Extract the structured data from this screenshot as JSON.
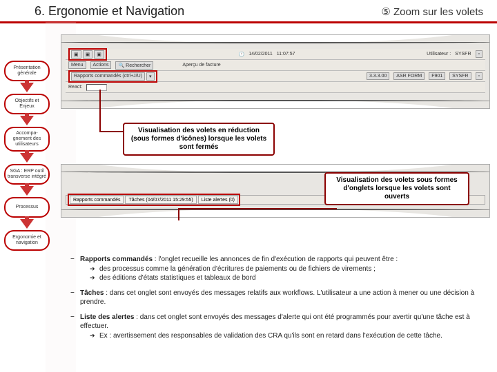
{
  "header": {
    "title": "6. Ergonomie et Navigation",
    "zoom_marker": "⑤",
    "zoom_label": "Zoom sur les volets"
  },
  "sidebar": {
    "items": [
      {
        "label": "Présentation générale"
      },
      {
        "label": "Objectifs et Enjeux"
      },
      {
        "label": "Accompa- gnement des utilisateurs"
      },
      {
        "label": "SGA : ERP outil transverse intégré"
      },
      {
        "label": "Processus"
      },
      {
        "label": "Ergonomie et navigation"
      }
    ]
  },
  "shot1": {
    "date": "14/02/2011",
    "time": "11:07:57",
    "user_label": "Utilisateur :",
    "user_value": "SYSFR",
    "menu": "Menu",
    "actions": "Actions",
    "search": "Rechercher",
    "preview": "Aperçu de facture",
    "reports_tab": "Rapports commandés (ctrl+J/U)",
    "status_a": "3.3.3.00",
    "status_b": "ASR FORM",
    "status_c": "F901",
    "status_d": "SYSFR",
    "react_label": "React:"
  },
  "callouts": {
    "closed": "Visualisation des volets en réduction (sous formes d'icônes) lorsque les volets sont fermés",
    "open": "Visualisation des volets sous formes d'onglets lorsque les volets sont ouverts"
  },
  "shot2": {
    "tab1": "Rapports commandés",
    "tab2": "Tâches (04/07/2011 15:29:55)",
    "tab3": "Liste alertes (0)"
  },
  "content": {
    "item1_bold": "Rapports commandés",
    "item1_rest": " : l'onglet recueille les annonces de fin d'exécution de rapports qui peuvent être :",
    "item1_sub1": "des processus comme la génération d'écritures de paiements ou de fichiers de virements ;",
    "item1_sub2": "des éditions d'états statistiques et tableaux de bord",
    "item2_bold": "Tâches",
    "item2_rest": " : dans cet onglet sont envoyés des messages relatifs aux workflows. L'utilisateur a une action à mener ou une décision à prendre.",
    "item3_bold": "Liste des alertes",
    "item3_rest": " : dans cet onglet sont envoyés des messages d'alerte qui ont été programmés pour avertir qu'une tâche est à effectuer.",
    "item3_sub1": "Ex : avertissement des responsables de validation des CRA qu'ils sont en retard dans l'exécution de cette tâche."
  }
}
